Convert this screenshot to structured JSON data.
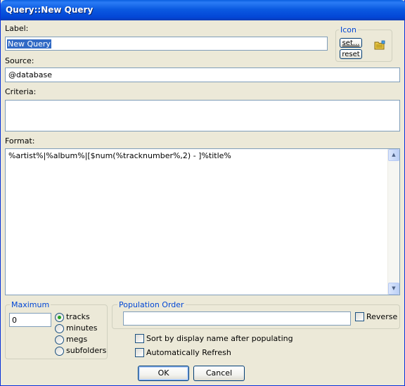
{
  "window": {
    "title": "Query::New Query"
  },
  "label_field": {
    "label": "Label:",
    "value": "New Query"
  },
  "icon_group": {
    "title": "Icon",
    "set_label": "set...",
    "reset_label": "reset",
    "icon": "folder-icon"
  },
  "source_field": {
    "label": "Source:",
    "value": "@database"
  },
  "criteria_field": {
    "label": "Criteria:",
    "value": ""
  },
  "format_field": {
    "label": "Format:",
    "value": "%artist%|%album%|[$num(%tracknumber%,2) - ]%title%"
  },
  "maximum_group": {
    "title": "Maximum",
    "value": "0",
    "options": [
      "tracks",
      "minutes",
      "megs",
      "subfolders"
    ],
    "selected": "tracks"
  },
  "population_group": {
    "title": "Population Order",
    "value": "",
    "reverse_label": "Reverse",
    "reverse_checked": false
  },
  "options": {
    "sort_label": "Sort by display name after populating",
    "sort_checked": false,
    "refresh_label": "Automatically Refresh",
    "refresh_checked": false
  },
  "buttons": {
    "ok_label": "OK",
    "cancel_label": "Cancel"
  },
  "colors": {
    "titlebar": "#0346d6",
    "window_bg": "#ece9d8",
    "group_title": "#0046d5",
    "selection": "#316ac5"
  }
}
